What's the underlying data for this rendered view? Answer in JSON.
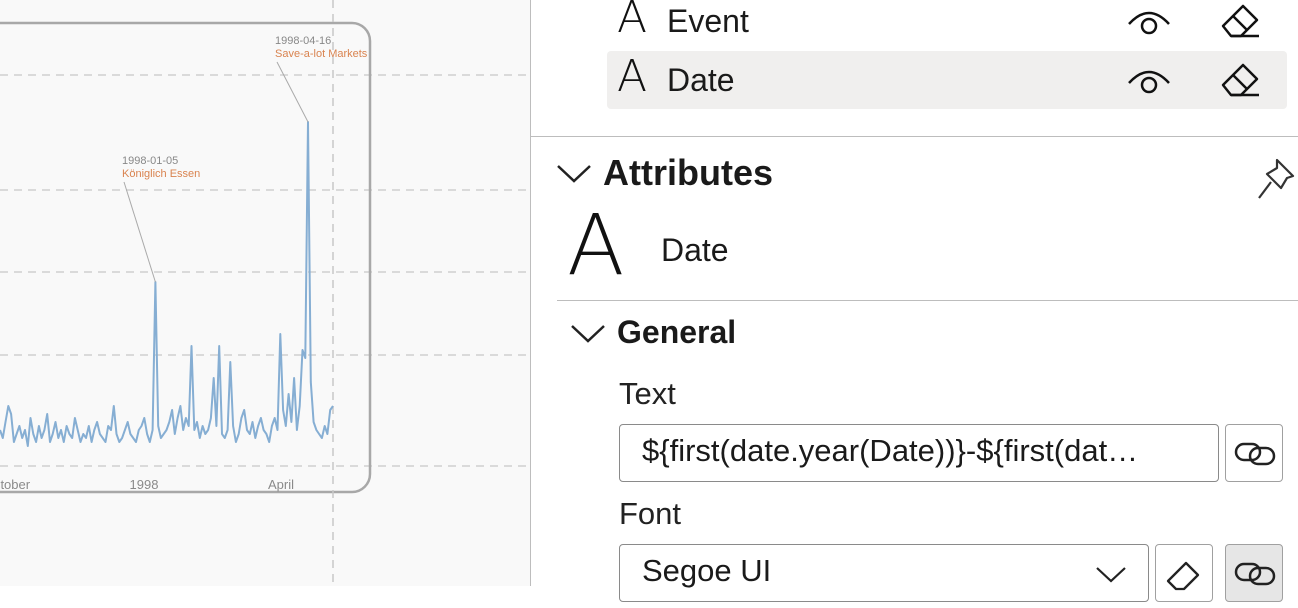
{
  "chart": {
    "chart_data": {
      "type": "line",
      "x_tick_labels": [
        "ctober",
        "1998",
        "April"
      ],
      "series": [
        {
          "values": [
            18,
            14,
            22,
            30,
            26,
            12,
            16,
            20,
            14,
            18,
            10,
            24,
            16,
            12,
            20,
            14,
            18,
            26,
            12,
            16,
            22,
            14,
            18,
            12,
            20,
            16,
            14,
            24,
            18,
            12,
            16,
            14,
            20,
            12,
            18,
            22,
            16,
            14,
            12,
            20,
            18,
            30,
            16,
            12,
            14,
            18,
            22,
            16,
            14,
            12,
            18,
            20,
            24,
            16,
            12,
            18,
            92,
            20,
            14,
            16,
            18,
            22,
            28,
            16,
            24,
            30,
            18,
            24,
            20,
            60,
            18,
            22,
            14,
            20,
            16,
            18,
            24,
            44,
            20,
            60,
            16,
            14,
            18,
            52,
            20,
            12,
            16,
            24,
            28,
            18,
            16,
            22,
            14,
            20,
            24,
            18,
            16,
            12,
            20,
            24,
            18,
            66,
            28,
            20,
            36,
            22,
            44,
            18,
            30,
            58,
            54,
            172,
            42,
            22,
            18,
            16,
            14,
            20,
            16,
            28,
            30
          ]
        }
      ],
      "annotations": [
        {
          "date": "1998-04-16",
          "label": "Save-a-lot Markets"
        },
        {
          "date": "1998-01-05",
          "label": "Königlich Essen"
        }
      ],
      "line_color": "#86aed3",
      "annotation_label_color": "#d9834f",
      "annotation_date_color": "#888888",
      "grid": "dashed horizontal"
    }
  },
  "layers": {
    "items": [
      {
        "glyph": "A",
        "name": "Event",
        "icon_visible": "eye-icon",
        "icon_clear": "eraser-icon"
      },
      {
        "glyph": "A",
        "name": "Date",
        "icon_visible": "eye-icon",
        "icon_clear": "eraser-icon",
        "selected": true
      }
    ]
  },
  "attributes": {
    "title": "Attributes",
    "pin_icon": "pin-icon",
    "item_glyph": "A",
    "item_name": "Date"
  },
  "general": {
    "title": "General",
    "text_label": "Text",
    "text_value": "${first(date.year(Date))}-${first(dat…",
    "font_label": "Font",
    "font_value": "Segoe UI"
  },
  "colors": {
    "accent_row": "#f0efee",
    "divider": "#bdbdbd"
  }
}
